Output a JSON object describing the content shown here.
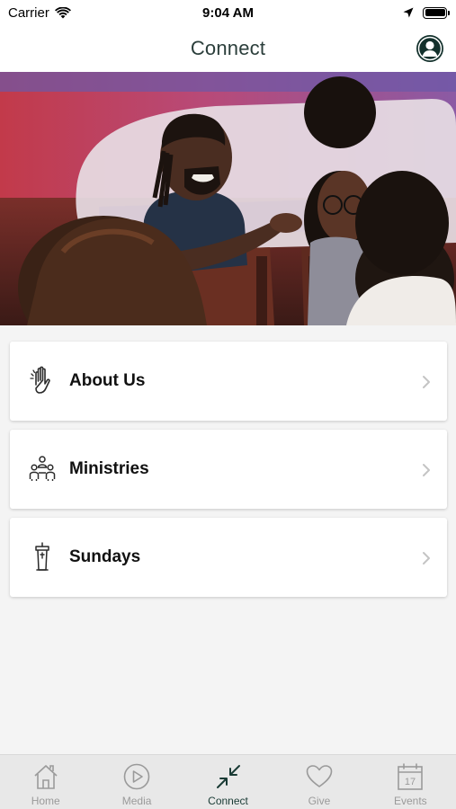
{
  "status_bar": {
    "carrier": "Carrier",
    "time": "9:04 AM"
  },
  "header": {
    "title": "Connect"
  },
  "menu": [
    {
      "label": "About Us",
      "icon": "raised-hand-icon"
    },
    {
      "label": "Ministries",
      "icon": "people-group-icon"
    },
    {
      "label": "Sundays",
      "icon": "pulpit-icon"
    }
  ],
  "tab_bar": {
    "items": [
      {
        "label": "Home",
        "icon": "home-icon",
        "active": false
      },
      {
        "label": "Media",
        "icon": "play-circle-icon",
        "active": false
      },
      {
        "label": "Connect",
        "icon": "connect-arrows-icon",
        "active": true
      },
      {
        "label": "Give",
        "icon": "heart-icon",
        "active": false
      },
      {
        "label": "Events",
        "icon": "calendar-icon",
        "active": false
      }
    ],
    "calendar_day": "17"
  },
  "colors": {
    "accent": "#1a3b35",
    "inactive": "#9a9a9a",
    "title": "#2b3e3b"
  }
}
